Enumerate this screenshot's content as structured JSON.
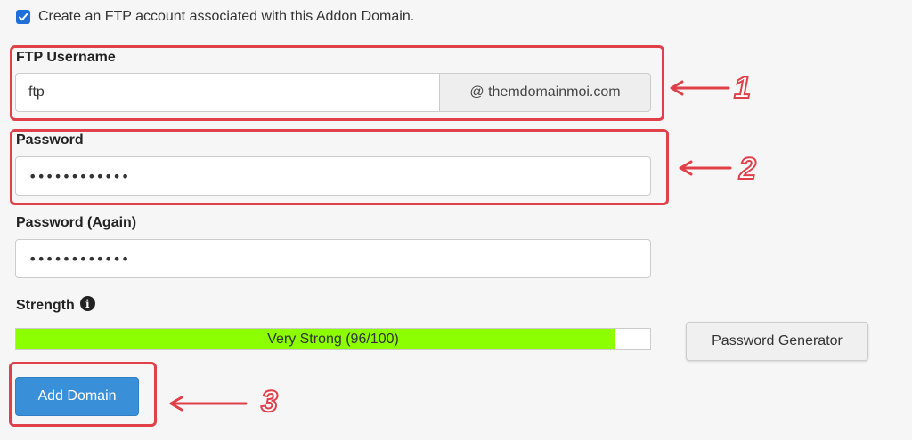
{
  "ftp_checkbox": {
    "checked": true,
    "label": "Create an FTP account associated with this Addon Domain."
  },
  "ftp_username": {
    "label": "FTP Username",
    "value": "ftp",
    "domain_suffix": "@ themdomainmoi.com"
  },
  "password": {
    "label": "Password",
    "value": "••••••••••••"
  },
  "password_again": {
    "label": "Password (Again)",
    "value": "••••••••••••"
  },
  "strength": {
    "label": "Strength",
    "score": 96,
    "max": 100,
    "text": "Very Strong (96/100)",
    "color": "#8cff00",
    "info_icon": "info-icon"
  },
  "buttons": {
    "password_generator": "Password Generator",
    "add_domain": "Add Domain"
  },
  "annotations": {
    "one": "1",
    "two": "2",
    "three": "3",
    "color": "#e0404a"
  }
}
